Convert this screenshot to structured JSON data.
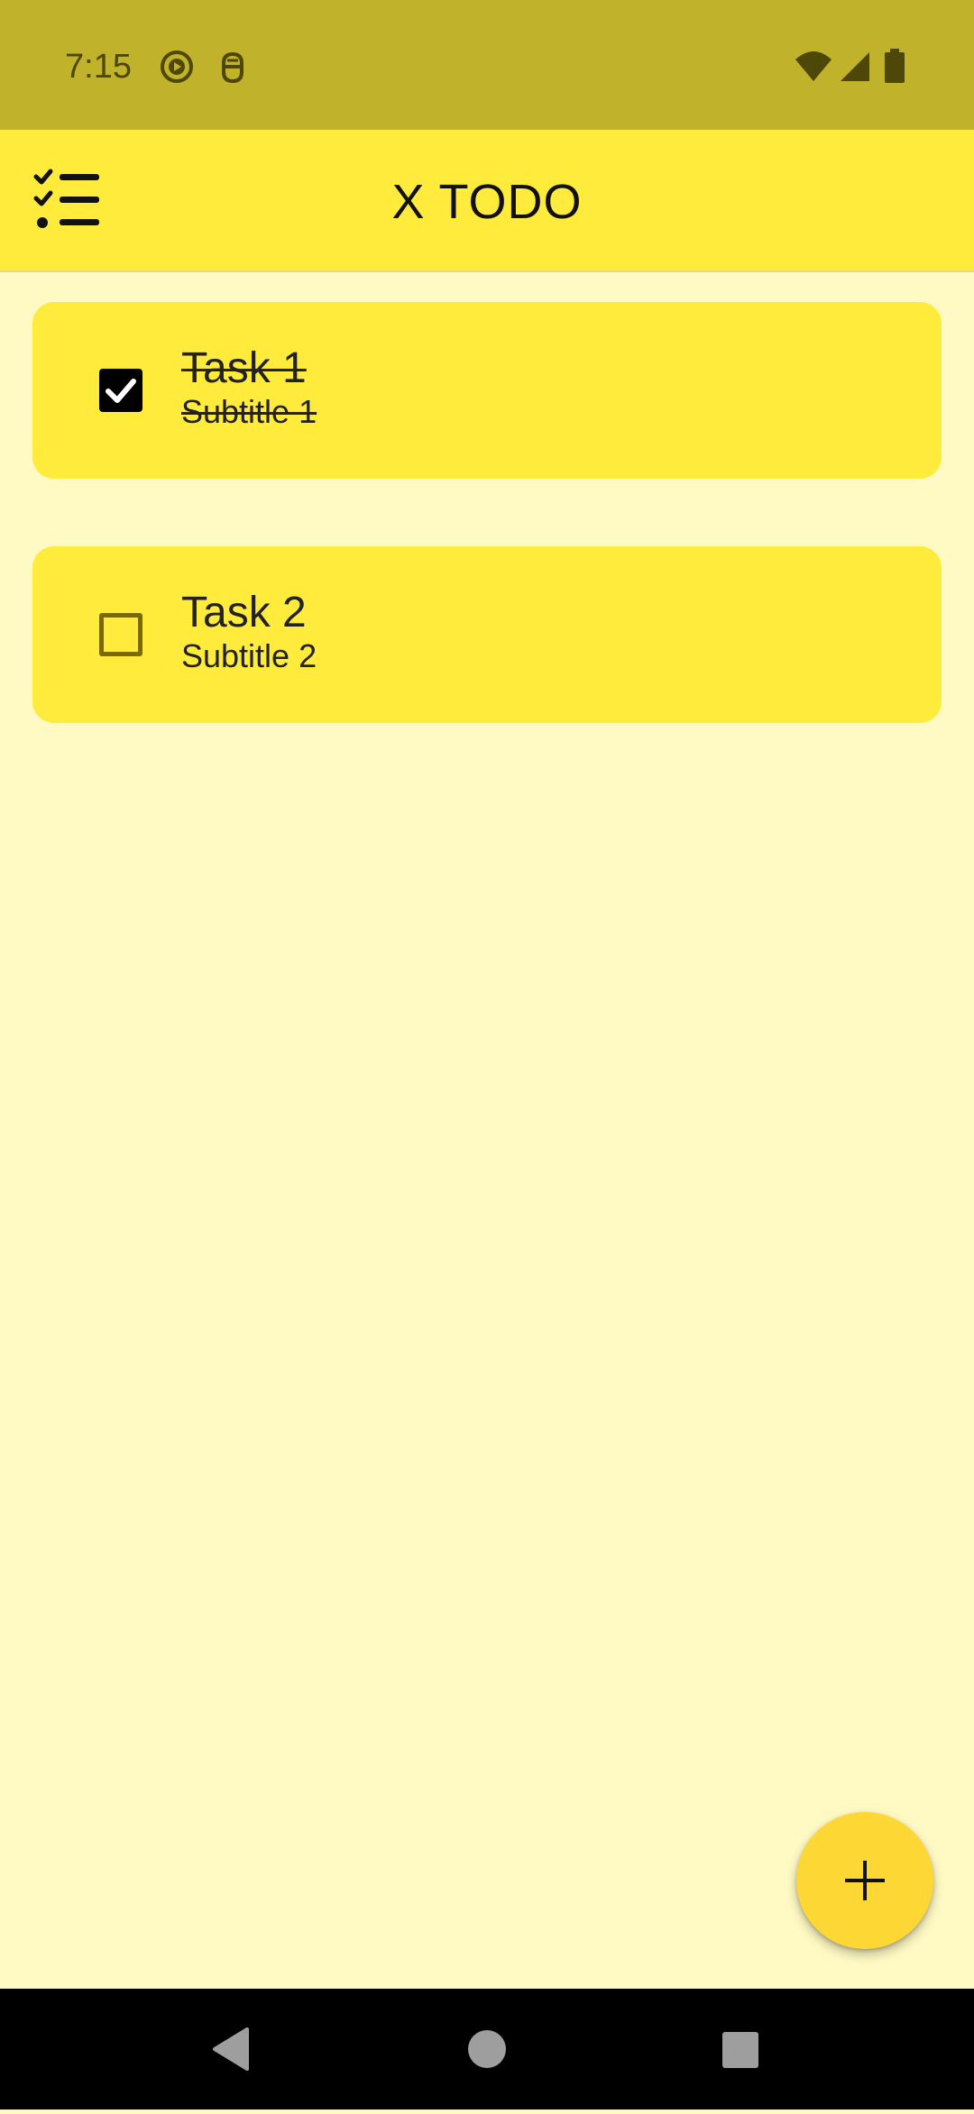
{
  "status_bar": {
    "time": "7:15",
    "icons": [
      "play-circle-icon",
      "bug-icon",
      "wifi-icon",
      "signal-icon",
      "battery-icon"
    ]
  },
  "app_bar": {
    "title": "X TODO",
    "menu_icon": "checklist-icon"
  },
  "tasks": [
    {
      "title": "Task 1",
      "subtitle": "Subtitle 1",
      "done": true
    },
    {
      "title": "Task 2",
      "subtitle": "Subtitle 2",
      "done": false
    }
  ],
  "fab": {
    "icon": "plus-icon"
  },
  "nav_bar": {
    "buttons": [
      "back-icon",
      "home-icon",
      "recents-icon"
    ]
  },
  "colors": {
    "status_bar": "#C0B22A",
    "app_bar": "#FFEB3B",
    "background": "#FFF9C4",
    "card": "#FFEB3B",
    "fab": "#FDD835"
  }
}
